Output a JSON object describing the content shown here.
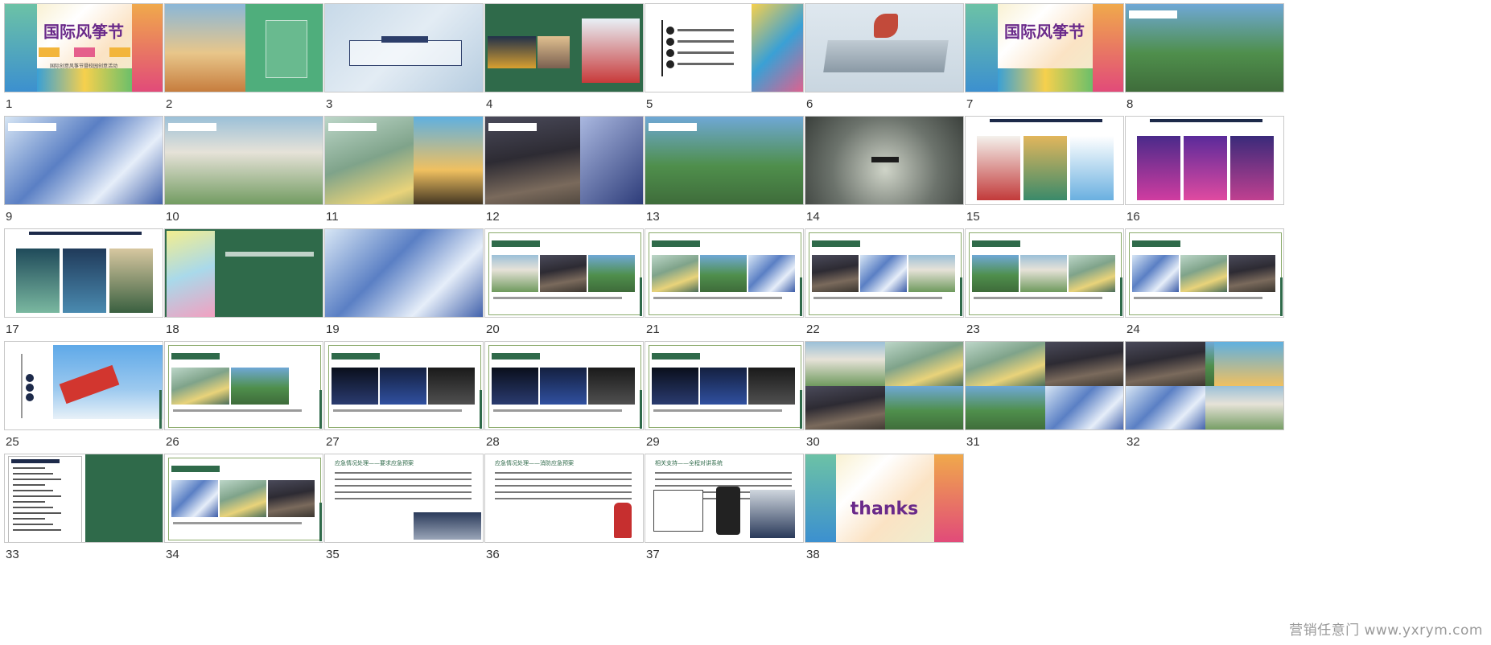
{
  "watermark": "营销任意门 www.yxrym.com",
  "slides": [
    {
      "n": "1",
      "kind": "cover",
      "title": "国际风筝节",
      "sub": "国际创意风筝节暨校园创意活动"
    },
    {
      "n": "2",
      "kind": "split",
      "title": "",
      "sub": ""
    },
    {
      "n": "3",
      "kind": "cloud",
      "title": "",
      "sub": ""
    },
    {
      "n": "4",
      "kind": "greenphoto",
      "title": "",
      "sub": ""
    },
    {
      "n": "5",
      "kind": "agenda",
      "title": "",
      "sub": ""
    },
    {
      "n": "6",
      "kind": "mist",
      "title": "",
      "sub": ""
    },
    {
      "n": "7",
      "kind": "cover",
      "title": "国际风筝节",
      "sub": ""
    },
    {
      "n": "8",
      "kind": "photo",
      "title": "",
      "sub": ""
    },
    {
      "n": "9",
      "kind": "photo",
      "title": "",
      "sub": ""
    },
    {
      "n": "10",
      "kind": "photo",
      "title": "",
      "sub": ""
    },
    {
      "n": "11",
      "kind": "photo",
      "title": "",
      "sub": ""
    },
    {
      "n": "12",
      "kind": "photo",
      "title": "",
      "sub": ""
    },
    {
      "n": "13",
      "kind": "photo",
      "title": "",
      "sub": ""
    },
    {
      "n": "14",
      "kind": "crowd",
      "title": "",
      "sub": ""
    },
    {
      "n": "15",
      "kind": "posters",
      "title": "",
      "sub": ""
    },
    {
      "n": "16",
      "kind": "posters",
      "title": "",
      "sub": ""
    },
    {
      "n": "17",
      "kind": "posters",
      "title": "",
      "sub": ""
    },
    {
      "n": "18",
      "kind": "greenphoto",
      "title": "",
      "sub": ""
    },
    {
      "n": "19",
      "kind": "photo",
      "title": "",
      "sub": ""
    },
    {
      "n": "20",
      "kind": "frame",
      "title": "",
      "sub": ""
    },
    {
      "n": "21",
      "kind": "frame",
      "title": "",
      "sub": ""
    },
    {
      "n": "22",
      "kind": "frame",
      "title": "",
      "sub": ""
    },
    {
      "n": "23",
      "kind": "frame",
      "title": "",
      "sub": ""
    },
    {
      "n": "24",
      "kind": "frame",
      "title": "",
      "sub": ""
    },
    {
      "n": "25",
      "kind": "kite",
      "title": "",
      "sub": ""
    },
    {
      "n": "26",
      "kind": "frame",
      "title": "",
      "sub": ""
    },
    {
      "n": "27",
      "kind": "frame",
      "title": "",
      "sub": ""
    },
    {
      "n": "28",
      "kind": "frame",
      "title": "",
      "sub": ""
    },
    {
      "n": "29",
      "kind": "frame",
      "title": "",
      "sub": ""
    },
    {
      "n": "30",
      "kind": "collage",
      "title": "",
      "sub": ""
    },
    {
      "n": "31",
      "kind": "collage",
      "title": "",
      "sub": ""
    },
    {
      "n": "32",
      "kind": "collage",
      "title": "",
      "sub": ""
    },
    {
      "n": "33",
      "kind": "toc",
      "title": "",
      "sub": ""
    },
    {
      "n": "34",
      "kind": "frame",
      "title": "",
      "sub": ""
    },
    {
      "n": "35",
      "kind": "text",
      "title": "应急情况处理——要求应急预案",
      "sub": ""
    },
    {
      "n": "36",
      "kind": "text",
      "title": "应急情况处理——消防应急预案",
      "sub": ""
    },
    {
      "n": "37",
      "kind": "text",
      "title": "相关支持——全程对讲系统",
      "sub": ""
    },
    {
      "n": "38",
      "kind": "thanks",
      "title": "thanks",
      "sub": ""
    }
  ],
  "colors": {
    "green": "#2f6a4a",
    "number": "#333333",
    "border": "#c8c8c8"
  }
}
